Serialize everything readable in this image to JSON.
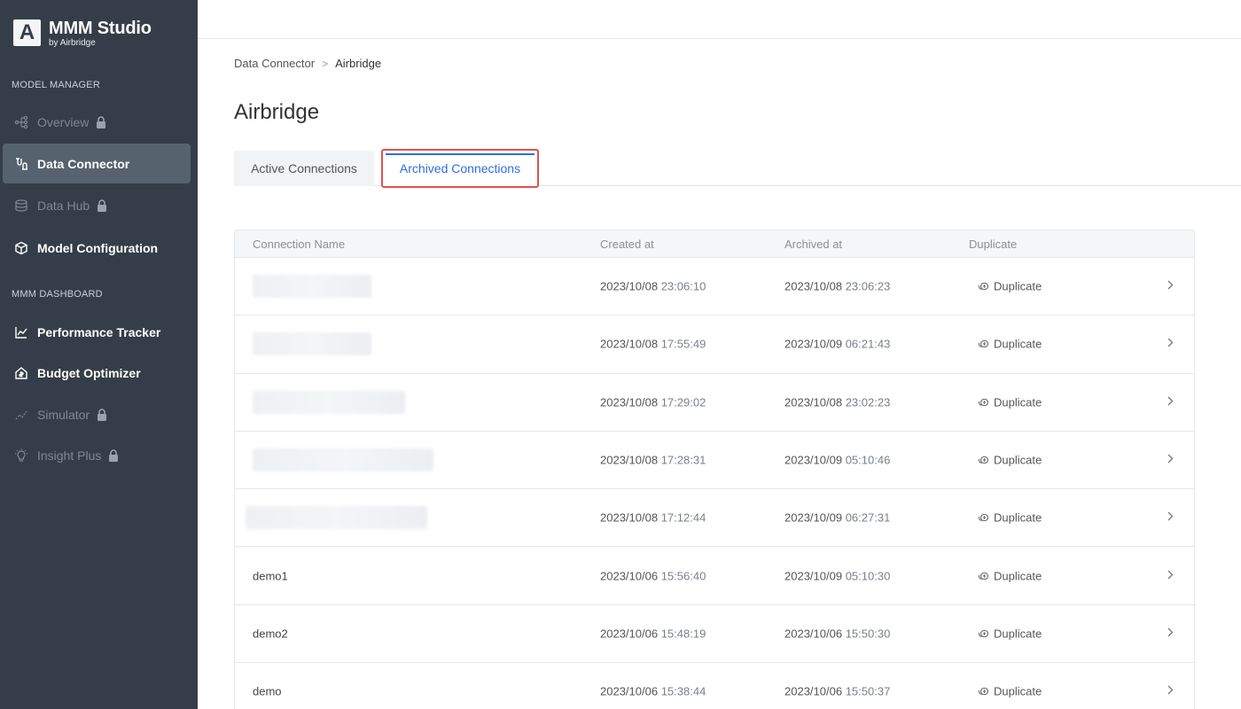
{
  "app": {
    "logo_letter": "A",
    "title": "MMM Studio",
    "subtitle": "by Airbridge"
  },
  "sidebar": {
    "sections": [
      {
        "label": "MODEL MANAGER"
      },
      {
        "label": "MMM DASHBOARD"
      }
    ],
    "items": [
      {
        "label": "Overview",
        "icon": "flow-icon",
        "locked": true,
        "active": false
      },
      {
        "label": "Data Connector",
        "icon": "connector-icon",
        "locked": false,
        "active": true
      },
      {
        "label": "Data Hub",
        "icon": "database-icon",
        "locked": true,
        "active": false
      },
      {
        "label": "Model Configuration",
        "icon": "cube-icon",
        "locked": false,
        "active": false
      },
      {
        "label": "Performance Tracker",
        "icon": "trend-icon",
        "locked": false,
        "active": false
      },
      {
        "label": "Budget Optimizer",
        "icon": "budget-icon",
        "locked": false,
        "active": false
      },
      {
        "label": "Simulator",
        "icon": "simulator-icon",
        "locked": true,
        "active": false
      },
      {
        "label": "Insight Plus",
        "icon": "lightbulb-icon",
        "locked": true,
        "active": false
      }
    ]
  },
  "breadcrumb": {
    "parent": "Data Connector",
    "separator": ">",
    "current": "Airbridge"
  },
  "page": {
    "title": "Airbridge"
  },
  "tabs": {
    "active": "Active Connections",
    "archived": "Archived Connections",
    "selected": "Archived Connections"
  },
  "table": {
    "headers": {
      "name": "Connection Name",
      "created": "Created at",
      "archived": "Archived at",
      "duplicate": "Duplicate"
    },
    "duplicate_label": "Duplicate",
    "rows": [
      {
        "name": "",
        "name_blurred": true,
        "created_date": "2023/10/08",
        "created_time": "23:06:10",
        "archived_date": "2023/10/08",
        "archived_time": "23:06:23"
      },
      {
        "name": "",
        "name_blurred": true,
        "created_date": "2023/10/08",
        "created_time": "17:55:49",
        "archived_date": "2023/10/09",
        "archived_time": "06:21:43"
      },
      {
        "name": "",
        "name_blurred": true,
        "created_date": "2023/10/08",
        "created_time": "17:29:02",
        "archived_date": "2023/10/08",
        "archived_time": "23:02:23"
      },
      {
        "name": "",
        "name_blurred": true,
        "created_date": "2023/10/08",
        "created_time": "17:28:31",
        "archived_date": "2023/10/09",
        "archived_time": "05:10:46"
      },
      {
        "name": "",
        "name_blurred": true,
        "created_date": "2023/10/08",
        "created_time": "17:12:44",
        "archived_date": "2023/10/09",
        "archived_time": "06:27:31"
      },
      {
        "name": "demo1",
        "name_blurred": false,
        "created_date": "2023/10/06",
        "created_time": "15:56:40",
        "archived_date": "2023/10/09",
        "archived_time": "05:10:30"
      },
      {
        "name": "demo2",
        "name_blurred": false,
        "created_date": "2023/10/06",
        "created_time": "15:48:19",
        "archived_date": "2023/10/06",
        "archived_time": "15:50:30"
      },
      {
        "name": "demo",
        "name_blurred": false,
        "created_date": "2023/10/06",
        "created_time": "15:38:44",
        "archived_date": "2023/10/06",
        "archived_time": "15:50:37"
      }
    ]
  },
  "colors": {
    "sidebar_bg": "#353e48",
    "sidebar_active_bg": "#56626e",
    "accent": "#2f6de1",
    "highlight_border": "#e05252"
  }
}
